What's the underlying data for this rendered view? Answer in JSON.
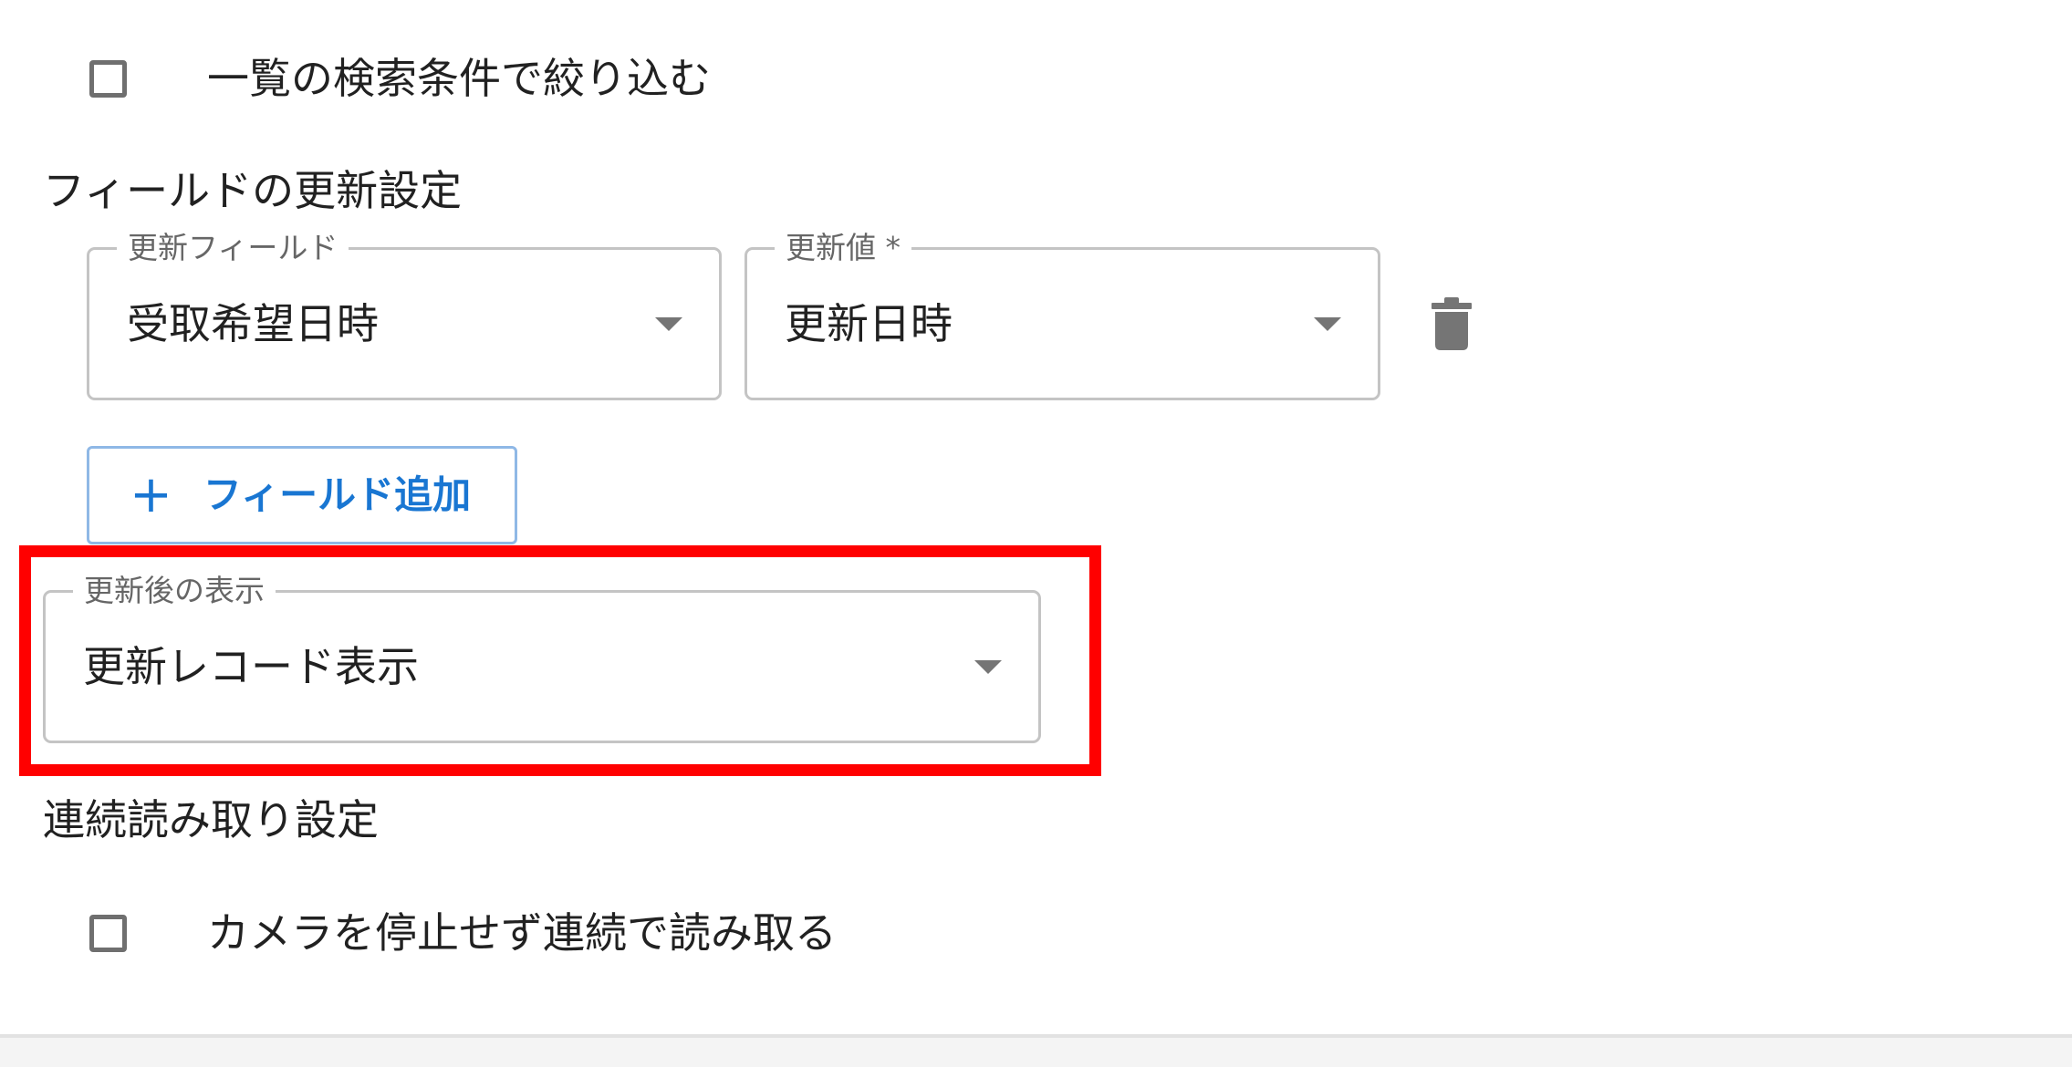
{
  "filter_checkbox": {
    "label": "一覧の検索条件で絞り込む",
    "checked": false
  },
  "field_update_section": {
    "heading": "フィールドの更新設定",
    "update_field": {
      "label": "更新フィールド",
      "value": "受取希望日時"
    },
    "update_value": {
      "label": "更新値 *",
      "value": "更新日時"
    },
    "delete_icon": "trash-icon",
    "add_field_button": {
      "icon": "plus-icon",
      "label": "フィールド追加"
    }
  },
  "after_update_display": {
    "label": "更新後の表示",
    "value": "更新レコード表示"
  },
  "continuous_read_section": {
    "heading": "連続読み取り設定",
    "checkbox": {
      "label": "カメラを停止せず連続で読み取る",
      "checked": false
    }
  },
  "colors": {
    "primary": "#1976d2",
    "highlight": "#ff0000",
    "outline": "#c4c4c4"
  }
}
